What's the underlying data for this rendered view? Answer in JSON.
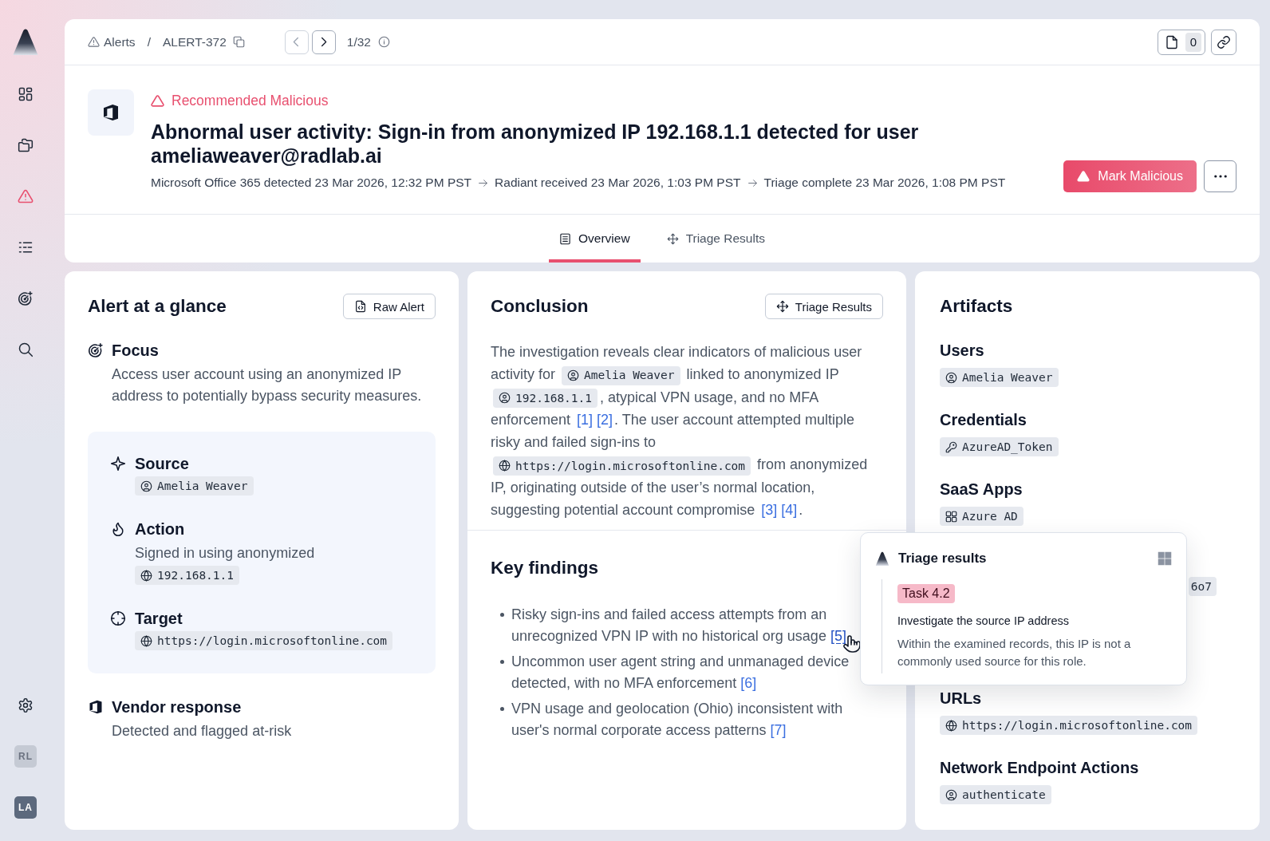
{
  "sidebar": {
    "nav": [
      {
        "kind": "dashboard",
        "selected": false
      },
      {
        "kind": "cases",
        "selected": false
      },
      {
        "kind": "alerts",
        "selected": true
      },
      {
        "kind": "queue",
        "selected": false
      },
      {
        "kind": "detections",
        "selected": false
      },
      {
        "kind": "search",
        "selected": false
      }
    ],
    "footer": [
      {
        "kind": "settings"
      },
      {
        "kind": "workspace",
        "initials": "RL"
      },
      {
        "kind": "user",
        "initials": "LA"
      }
    ]
  },
  "topbar": {
    "breadcrumb": {
      "section": "Alerts",
      "separator": "/",
      "current": "ALERT-372"
    },
    "pager": {
      "previous": {
        "disabled": true
      },
      "next": {
        "disabled": false
      },
      "position": "1/32"
    },
    "notes": {
      "count": "0"
    }
  },
  "alert": {
    "verdict": {
      "kind": "malicious",
      "label": "Recommended Malicious"
    },
    "title": "Abnormal user activity: Sign-in from anonymized IP 192.168.1.1 detected for user ameliaweaver@radlab.ai",
    "timeline": [
      "Microsoft Office 365 detected 23 Mar 2026, 12:32 PM PST",
      "Radiant received 23 Mar 2026, 1:03 PM PST",
      "Triage complete 23 Mar 2026, 1:08 PM PST"
    ],
    "primary_action": "Mark Malicious"
  },
  "tabs": [
    {
      "label": "Overview",
      "selected": true
    },
    {
      "label": "Triage Results",
      "selected": false
    }
  ],
  "glance": {
    "title": "Alert at a glance",
    "raw_button": "Raw Alert",
    "focus": {
      "heading": "Focus",
      "text": "Access user account using an anonymized IP address to potentially bypass security measures."
    },
    "panel": [
      {
        "heading": "Source",
        "chips": [
          {
            "kind": "user",
            "text": "Amelia Weaver"
          }
        ]
      },
      {
        "heading": "Action",
        "text": "Signed in using anonymized",
        "chips": [
          {
            "kind": "web",
            "text": "192.168.1.1"
          }
        ]
      },
      {
        "heading": "Target",
        "chips": [
          {
            "kind": "web",
            "text": "https://login.microsoftonline.com"
          }
        ]
      }
    ],
    "vendor": {
      "heading": "Vendor response",
      "text": "Detected and flagged at-risk"
    }
  },
  "conclusion": {
    "title": "Conclusion",
    "button": "Triage Results",
    "paragraph": [
      {
        "kind": "text",
        "text": "The investigation reveals clear indicators of malicious user activity for "
      },
      {
        "kind": "chip",
        "chip": {
          "kind": "user",
          "text": "Amelia Weaver"
        }
      },
      {
        "kind": "text",
        "text": " linked to anonymized IP "
      },
      {
        "kind": "chip",
        "chip": {
          "kind": "user",
          "text": "192.168.1.1"
        }
      },
      {
        "kind": "text",
        "text": ", atypical VPN usage, and no MFA enforcement "
      },
      {
        "kind": "cite",
        "text": "[1]"
      },
      {
        "kind": "cite",
        "text": "[2]"
      },
      {
        "kind": "text",
        "text": ". The user account attempted multiple risky and failed sign-ins to "
      },
      {
        "kind": "chip",
        "chip": {
          "kind": "web",
          "text": "https://login.microsoftonline.com"
        }
      },
      {
        "kind": "text",
        "text": " from anonymized IP, originating outside of the user’s normal location, suggesting potential account compromise "
      },
      {
        "kind": "cite",
        "text": "[3]"
      },
      {
        "kind": "cite",
        "text": "[4]"
      },
      {
        "kind": "text",
        "text": "."
      }
    ]
  },
  "key_findings": {
    "title": "Key findings",
    "items": [
      {
        "text": "Risky sign-ins and failed access attempts from an unrecognized VPN IP with no historical org usage",
        "cite": "[5]",
        "hovered": true
      },
      {
        "text": "Uncommon user agent string and unmanaged device detected, with no MFA enforcement",
        "cite": "[6]",
        "hovered": false
      },
      {
        "text": "VPN usage and geolocation (Ohio) inconsistent with user's normal corporate access patterns",
        "cite": "[7]",
        "hovered": false
      }
    ]
  },
  "artifacts": {
    "title": "Artifacts",
    "sections": [
      {
        "kind": "listed",
        "heading": "Users",
        "chips": [
          {
            "kind": "user",
            "text": "Amelia Weaver"
          }
        ]
      },
      {
        "kind": "listed",
        "heading": "Credentials",
        "chips": [
          {
            "kind": "key",
            "text": "AzureAD_Token"
          }
        ]
      },
      {
        "kind": "listed",
        "heading": "SaaS Apps",
        "chips": [
          {
            "kind": "app",
            "text": "Azure AD"
          }
        ]
      },
      {
        "kind": "covered",
        "chips": [
          {
            "kind": "partial",
            "text": "6o7"
          }
        ]
      },
      {
        "kind": "listed",
        "heading": "URLs",
        "chips": [
          {
            "kind": "web",
            "text": "https://login.microsoftonline.com"
          }
        ]
      },
      {
        "kind": "listed",
        "heading": "Network Endpoint Actions",
        "chips": [
          {
            "kind": "user",
            "text": "authenticate"
          }
        ]
      }
    ]
  },
  "triage_popup": {
    "title": "Triage results",
    "task": "Task 4.2",
    "heading": "Investigate the source IP address",
    "text": "Within the examined records, this IP is not a commonly used source for this role."
  }
}
